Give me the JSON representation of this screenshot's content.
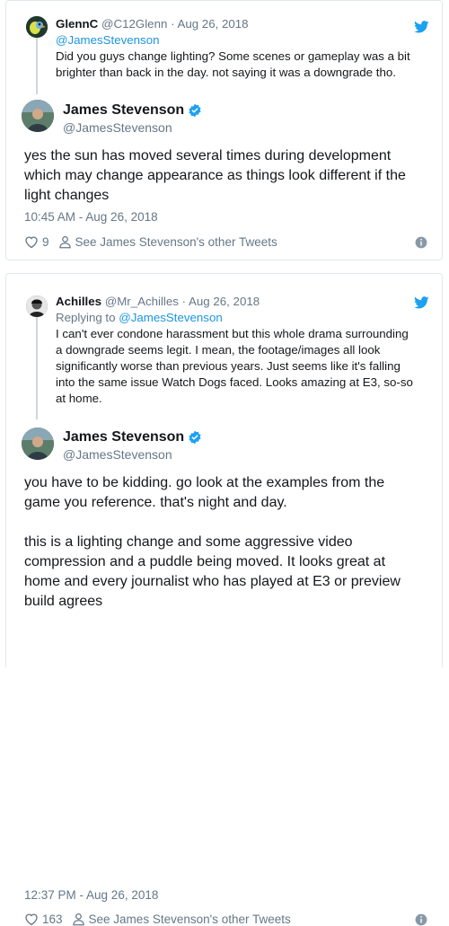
{
  "tweet1": {
    "parent": {
      "name": "GlennC",
      "handle": "@C12Glenn",
      "date": "· Aug 26, 2018",
      "mention": "@JamesStevenson",
      "text": "Did you guys change lighting? Some scenes or gameplay was a bit brighter than back in the day. not saying it was a downgrade tho."
    },
    "author": {
      "name": "James Stevenson",
      "handle": "@JamesStevenson"
    },
    "body": [
      "yes the sun has moved several times during development which may change appearance as things look different if the light changes"
    ],
    "timestamp": "10:45 AM - Aug 26, 2018",
    "likes": "9",
    "other_tweets": "See James Stevenson's other Tweets"
  },
  "tweet2": {
    "parent": {
      "name": "Achilles",
      "handle": "@Mr_Achilles",
      "date": "· Aug 26, 2018",
      "reply_prefix": "Replying to",
      "mention": "@JamesStevenson",
      "text": "I can't ever condone harassment but this whole drama surrounding a downgrade seems legit. I mean, the footage/images all look significantly worse than previous years. Just seems like it's falling into the same issue Watch Dogs faced. Looks amazing at E3, so-so at home."
    },
    "author": {
      "name": "James Stevenson",
      "handle": "@JamesStevenson"
    },
    "body": [
      "you have to be kidding. go look at the examples from the game you reference. that's night and day.",
      "this is a lighting change and some aggressive video compression and a puddle being moved. It looks great at home and every journalist who has played at E3 or preview build agrees"
    ],
    "timestamp": "12:37 PM - Aug 26, 2018",
    "likes": "163",
    "other_tweets": "See James Stevenson's other Tweets"
  },
  "colors": {
    "twitter_blue": "#1da1f2",
    "link": "#1b95e0",
    "muted": "#657786",
    "text": "#14171a",
    "border": "#e1e8ed"
  }
}
